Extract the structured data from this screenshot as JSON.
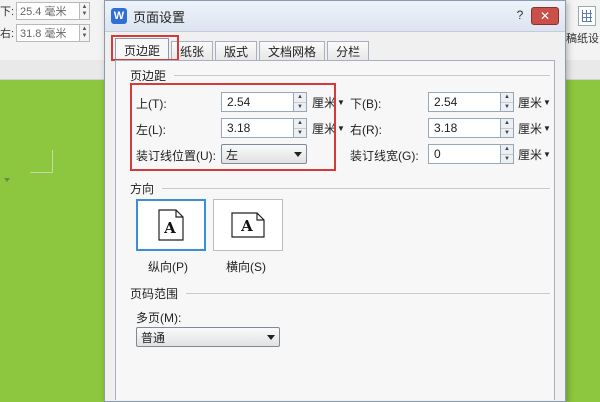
{
  "background": {
    "bottom_label": "下:",
    "bottom_value": "25.4 毫米",
    "right_label": "右:",
    "right_value": "31.8 毫米",
    "right_tool_label": "稿纸设"
  },
  "dialog": {
    "title": "页面设置",
    "app_icon_glyph": "W",
    "help_glyph": "?",
    "close_glyph": "✕",
    "tabs": [
      "页边距",
      "纸张",
      "版式",
      "文档网格",
      "分栏"
    ],
    "active_tab": "页边距",
    "highlight_color": "#d43a3a"
  },
  "margins": {
    "section_title": "页边距",
    "top": {
      "label": "上(T):",
      "value": "2.54",
      "unit": "厘米"
    },
    "bottom": {
      "label": "下(B):",
      "value": "2.54",
      "unit": "厘米"
    },
    "left": {
      "label": "左(L):",
      "value": "3.18",
      "unit": "厘米"
    },
    "right": {
      "label": "右(R):",
      "value": "3.18",
      "unit": "厘米"
    },
    "gutter_pos": {
      "label": "装订线位置(U):",
      "value": "左"
    },
    "gutter_width": {
      "label": "装订线宽(G):",
      "value": "0",
      "unit": "厘米"
    }
  },
  "orientation": {
    "section_title": "方向",
    "icon_letter": "A",
    "portrait_label": "纵向(P)",
    "landscape_label": "横向(S)",
    "selected": "纵向(P)",
    "selected_color": "#3c8fd6"
  },
  "pages": {
    "section_title": "页码范围",
    "multi_label": "多页(M):",
    "multi_value": "普通"
  }
}
